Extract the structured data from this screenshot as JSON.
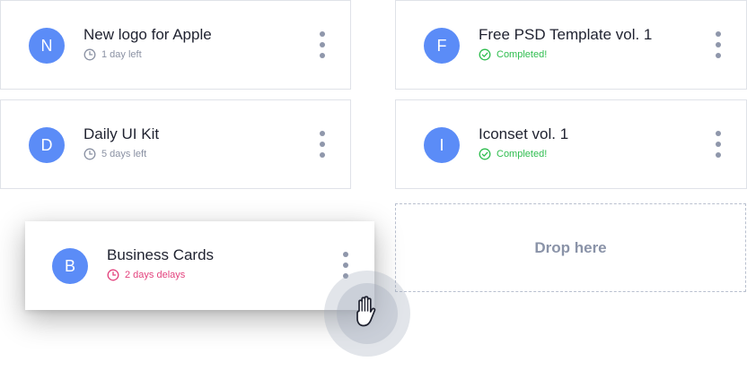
{
  "cards": [
    {
      "initial": "N",
      "title": "New logo for Apple",
      "status": "1 day left",
      "status_icon": "clock-icon"
    },
    {
      "initial": "D",
      "title": "Daily UI Kit",
      "status": "5 days left",
      "status_icon": "clock-icon"
    },
    {
      "initial": "F",
      "title": "Free PSD Template vol. 1",
      "status": "Completed!",
      "status_icon": "check-circle-icon"
    },
    {
      "initial": "I",
      "title": "Iconset vol. 1",
      "status": "Completed!",
      "status_icon": "check-circle-icon"
    }
  ],
  "dragging_card": {
    "initial": "B",
    "title": "Business Cards",
    "status": "2 days delays",
    "status_icon": "clock-icon"
  },
  "dropzone": {
    "label": "Drop here"
  },
  "colors": {
    "avatar": "#5b8cf7",
    "pending": "#8a91a3",
    "completed": "#2fbd4f",
    "delayed": "#e3427d",
    "more_dots": "#8f97ab"
  }
}
